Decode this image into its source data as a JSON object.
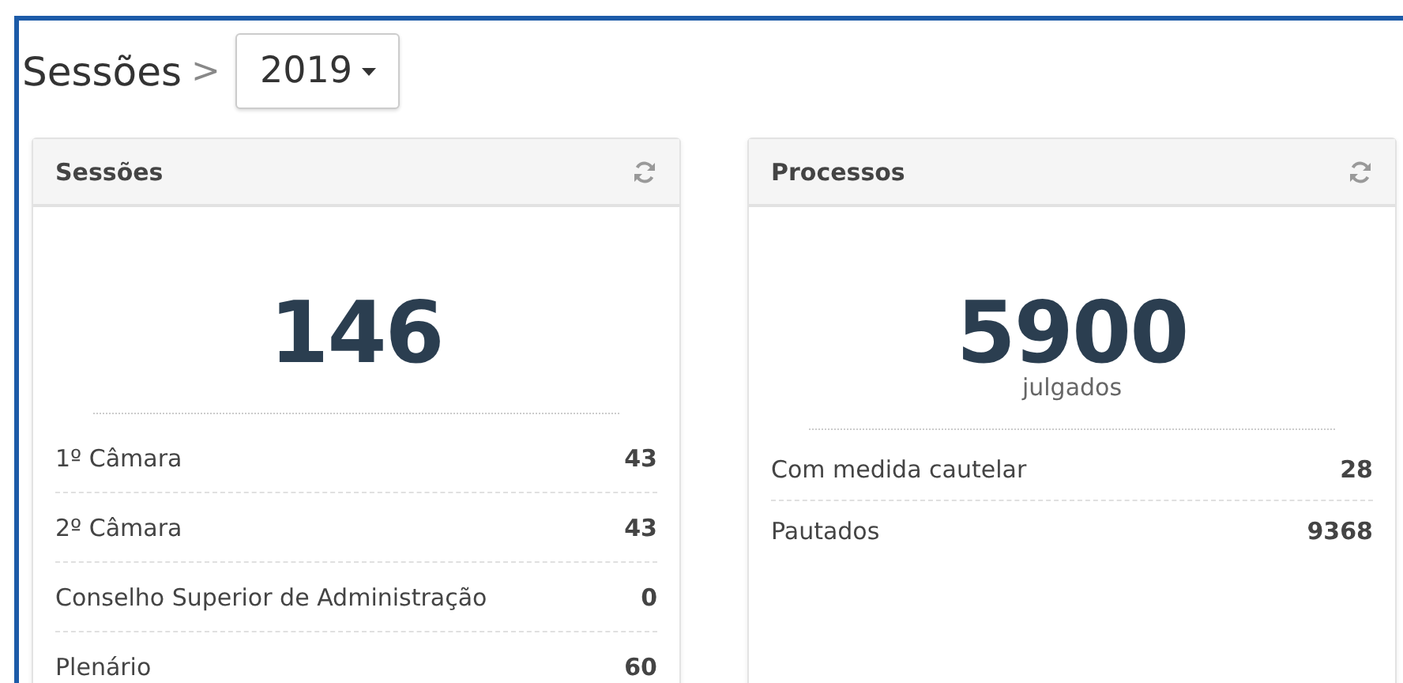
{
  "breadcrumb": {
    "title": "Sessões",
    "separator": ">"
  },
  "year_dropdown": {
    "value": "2019"
  },
  "panels": [
    {
      "title": "Sessões",
      "total": "146",
      "rows": [
        {
          "label": "1º Câmara",
          "value": "43"
        },
        {
          "label": "2º Câmara",
          "value": "43"
        },
        {
          "label": "Conselho Superior de Administração",
          "value": "0"
        },
        {
          "label": "Plenário",
          "value": "60"
        }
      ]
    },
    {
      "title": "Processos",
      "total": "5900",
      "caption": "julgados",
      "rows": [
        {
          "label": "Com medida cautelar",
          "value": "28"
        },
        {
          "label": "Pautados",
          "value": "9368"
        }
      ]
    }
  ]
}
